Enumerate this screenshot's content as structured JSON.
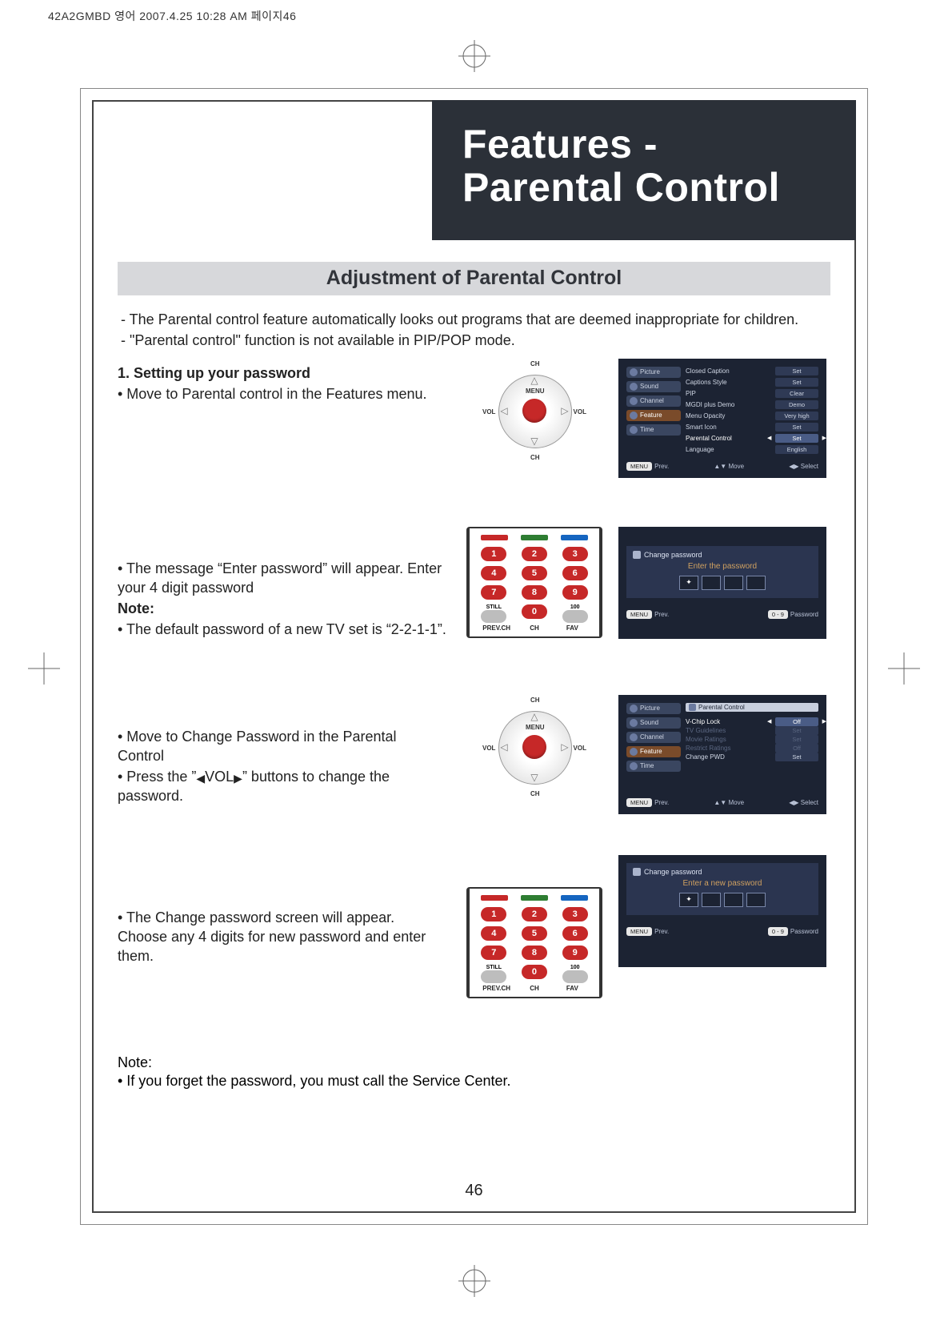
{
  "header_line": "42A2GMBD 영어  2007.4.25 10:28 AM 페이지46",
  "title_line1": "Features -",
  "title_line2": "Parental Control",
  "section_heading": "Adjustment of Parental Control",
  "intro_line1": "- The Parental control feature automatically looks out programs that are deemed inappropriate for children.",
  "intro_line2": "- \"Parental control\" function is not available in PIP/POP mode.",
  "step1_heading": "1. Setting up your password",
  "step1_line": "• Move to Parental control in the Features menu.",
  "step2_line1": "• The message “Enter password” will appear. Enter your 4 digit password",
  "step2_note_label": "Note:",
  "step2_note_line": "• The default password of a new TV set is “2-2-1-1”.",
  "step3_line1": "• Move to Change Password in the Parental Control",
  "step3_line2_a": "• Press the ”",
  "step3_line2_b": "VOL",
  "step3_line2_c": "” buttons to change the password.",
  "step4_line": "• The Change password screen will appear. Choose any 4 digits for new password and enter them.",
  "footer_note_label": "Note:",
  "footer_note_line": "• If you forget the password, you must call the Service Center.",
  "page_number": "46",
  "dpad": {
    "menu": "MENU",
    "ch": "CH",
    "vol": "VOL"
  },
  "keypad": {
    "numbers": [
      "1",
      "2",
      "3",
      "4",
      "5",
      "6",
      "7",
      "8",
      "9",
      "",
      "0",
      ""
    ],
    "label_left": "STILL",
    "label_right": "100",
    "bottom_labels": [
      "PREV.CH",
      "CH",
      "FAV"
    ]
  },
  "osd_features": {
    "menu_items": [
      "Picture",
      "Sound",
      "Channel",
      "Feature",
      "Time"
    ],
    "active_index": 3,
    "options": [
      {
        "label": "Closed Caption",
        "value": "Set"
      },
      {
        "label": "Captions Style",
        "value": "Set"
      },
      {
        "label": "PIP",
        "value": "Clear"
      },
      {
        "label": "MGDI plus Demo",
        "value": "Demo"
      },
      {
        "label": "Menu Opacity",
        "value": "Very high"
      },
      {
        "label": "Smart Icon",
        "value": "Set"
      },
      {
        "label": "Parental Control",
        "value": "Set",
        "selected": true
      },
      {
        "label": "Language",
        "value": "English"
      }
    ],
    "footer": {
      "menu": "MENU",
      "prev": "Prev.",
      "move": "Move",
      "select": "Select"
    }
  },
  "osd_enter_pw": {
    "title": "Change password",
    "prompt": "Enter the password",
    "filled": 1,
    "footer": {
      "menu": "MENU",
      "prev": "Prev.",
      "range": "0 - 9",
      "pwd": "Password"
    }
  },
  "osd_parental": {
    "menu_items": [
      "Picture",
      "Sound",
      "Channel",
      "Feature",
      "Time"
    ],
    "active_index": 3,
    "heading": "Parental Control",
    "options": [
      {
        "label": "V-Chip Lock",
        "value": "Off",
        "selected": true
      },
      {
        "label": "TV Guidelines",
        "value": "Set",
        "dim": true
      },
      {
        "label": "Movie Ratings",
        "value": "Set",
        "dim": true
      },
      {
        "label": "Restrict Ratings",
        "value": "Off",
        "dim": true
      },
      {
        "label": "Change PWD",
        "value": "Set"
      }
    ],
    "footer": {
      "menu": "MENU",
      "prev": "Prev.",
      "move": "Move",
      "select": "Select"
    }
  },
  "osd_new_pw": {
    "title": "Change password",
    "prompt": "Enter a new password",
    "filled": 1,
    "footer": {
      "menu": "MENU",
      "prev": "Prev.",
      "range": "0 - 9",
      "pwd": "Password"
    }
  }
}
